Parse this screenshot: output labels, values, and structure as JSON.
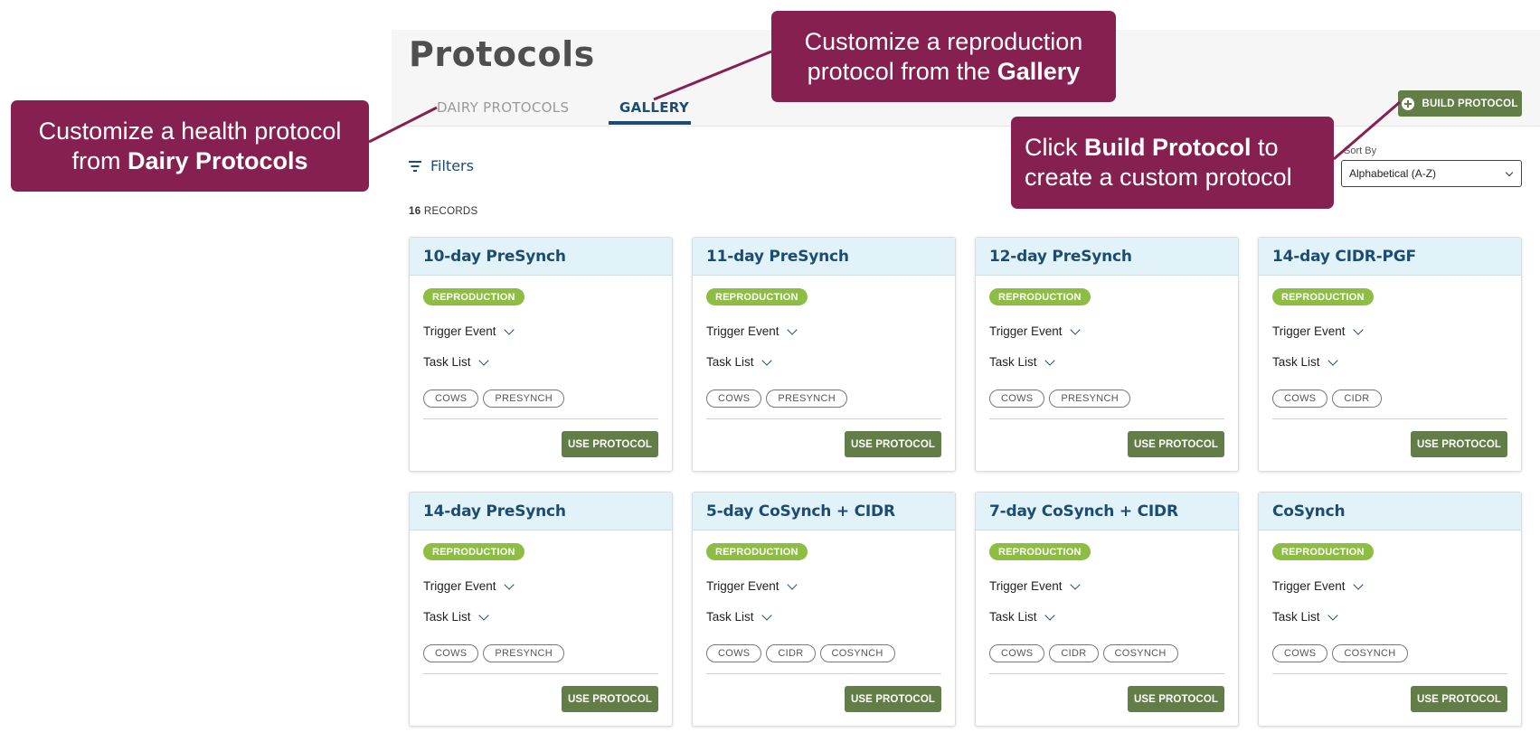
{
  "page": {
    "title": "Protocols",
    "tabs": [
      {
        "label": "DAIRY PROTOCOLS",
        "active": false
      },
      {
        "label": "GALLERY",
        "active": true
      }
    ],
    "build_button": {
      "label": "BUILD PROTOCOL",
      "icon": "plus-circle-icon"
    },
    "filters_label": "Filters",
    "records_count": "16",
    "records_label": "RECORDS",
    "sort": {
      "label": "Sort By",
      "value": "Alphabetical (A-Z)"
    }
  },
  "cards": [
    {
      "title": "10-day PreSynch",
      "badge": "REPRODUCTION",
      "trigger_label": "Trigger Event",
      "task_label": "Task List",
      "tags": [
        "COWS",
        "PRESYNCH"
      ],
      "button": "USE PROTOCOL"
    },
    {
      "title": "11-day PreSynch",
      "badge": "REPRODUCTION",
      "trigger_label": "Trigger Event",
      "task_label": "Task List",
      "tags": [
        "COWS",
        "PRESYNCH"
      ],
      "button": "USE PROTOCOL"
    },
    {
      "title": "12-day PreSynch",
      "badge": "REPRODUCTION",
      "trigger_label": "Trigger Event",
      "task_label": "Task List",
      "tags": [
        "COWS",
        "PRESYNCH"
      ],
      "button": "USE PROTOCOL"
    },
    {
      "title": "14-day CIDR-PGF",
      "badge": "REPRODUCTION",
      "trigger_label": "Trigger Event",
      "task_label": "Task List",
      "tags": [
        "COWS",
        "CIDR"
      ],
      "button": "USE PROTOCOL"
    },
    {
      "title": "14-day PreSynch",
      "badge": "REPRODUCTION",
      "trigger_label": "Trigger Event",
      "task_label": "Task List",
      "tags": [
        "COWS",
        "PRESYNCH"
      ],
      "button": "USE PROTOCOL"
    },
    {
      "title": "5-day CoSynch + CIDR",
      "badge": "REPRODUCTION",
      "trigger_label": "Trigger Event",
      "task_label": "Task List",
      "tags": [
        "COWS",
        "CIDR",
        "COSYNCH"
      ],
      "button": "USE PROTOCOL"
    },
    {
      "title": "7-day CoSynch + CIDR",
      "badge": "REPRODUCTION",
      "trigger_label": "Trigger Event",
      "task_label": "Task List",
      "tags": [
        "COWS",
        "CIDR",
        "COSYNCH"
      ],
      "button": "USE PROTOCOL"
    },
    {
      "title": "CoSynch",
      "badge": "REPRODUCTION",
      "trigger_label": "Trigger Event",
      "task_label": "Task List",
      "tags": [
        "COWS",
        "COSYNCH"
      ],
      "button": "USE PROTOCOL"
    }
  ],
  "callouts": {
    "dairy": {
      "line1": "Customize a health protocol",
      "line2_prefix": "from ",
      "line2_bold": "Dairy Protocols"
    },
    "gallery": {
      "line1": "Customize a reproduction",
      "line2_prefix": "protocol from the ",
      "line2_bold": "Gallery"
    },
    "build": {
      "line1_prefix": "Click ",
      "line1_bold": "Build Protocol",
      "line1_suffix": " to",
      "line2": "create a custom protocol"
    }
  },
  "colors": {
    "accent_blue": "#1c4c72",
    "button_green": "#627d45",
    "badge_green": "#8ebd43",
    "card_header": "#e1f2f8",
    "callout": "#862050"
  }
}
